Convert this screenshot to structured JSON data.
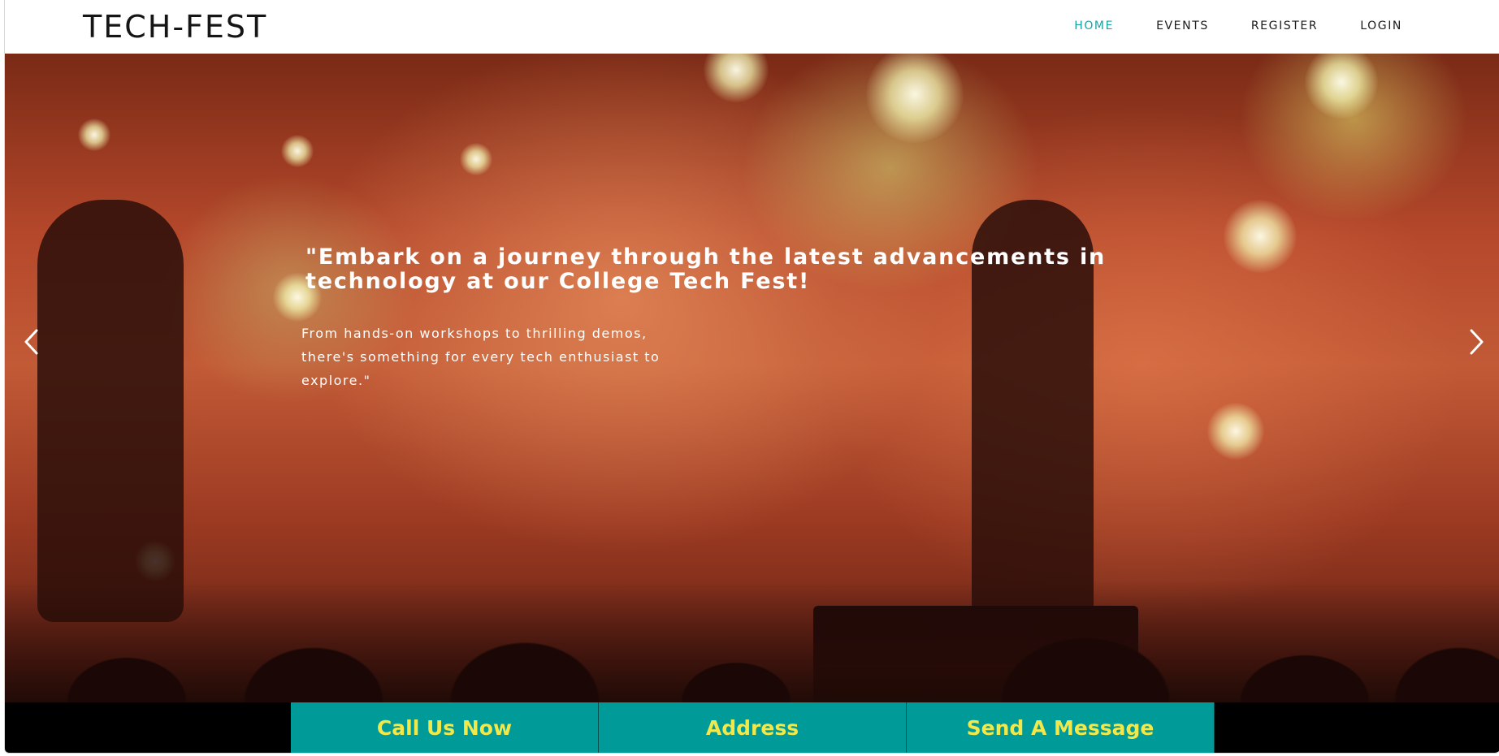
{
  "header": {
    "brand": "TECH-FEST",
    "nav": [
      {
        "label": "HOME",
        "active": true
      },
      {
        "label": "EVENTS",
        "active": false
      },
      {
        "label": "REGISTER",
        "active": false
      },
      {
        "label": "LOGIN",
        "active": false
      }
    ]
  },
  "hero": {
    "title": "\"Embark on a journey through the latest advancements in technology at our College Tech Fest!",
    "subtitle": "From hands-on workshops to thrilling demos, there's something for every tech enthusiast to explore.\"",
    "prev_icon": "chevron-left-icon",
    "next_icon": "chevron-right-icon"
  },
  "cta": {
    "call": "Call Us Now",
    "address": "Address",
    "message": "Send A Message"
  },
  "colors": {
    "accent": "#1aa3a3",
    "cta_background": "#009a98",
    "cta_text": "#f2e84a",
    "bar_background": "#000000"
  }
}
